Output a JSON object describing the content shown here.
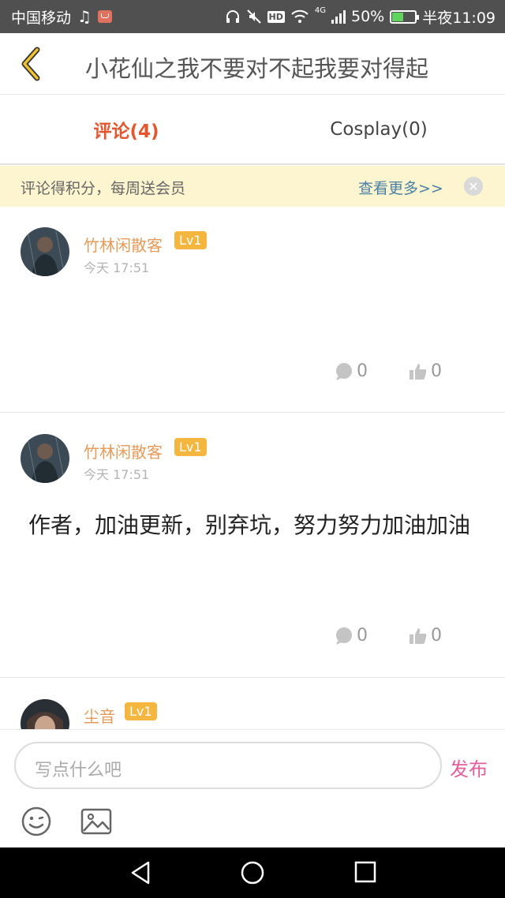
{
  "status_bar": {
    "carrier": "中国移动",
    "network": "4G",
    "battery": "50%",
    "time": "半夜11:09",
    "battery_level": 0.5,
    "icons": [
      "music-note-icon",
      "mail-icon",
      "headphones-icon",
      "mute-icon",
      "hd-icon",
      "wifi-icon",
      "signal-icon",
      "battery-icon"
    ]
  },
  "header": {
    "title": "小花仙之我不要对不起我要对得起",
    "back_icon": "chevron-left-icon"
  },
  "tabs": [
    {
      "label": "评论(4)",
      "active": true
    },
    {
      "label": "Cosplay(0)",
      "active": false
    }
  ],
  "notice": {
    "text": "评论得积分，每周送会员",
    "link": "查看更多>>",
    "close_icon": "close-icon"
  },
  "comments": [
    {
      "username": "竹林闲散客",
      "level": "Lv1",
      "time": "今天 17:51",
      "content": "",
      "replies": "0",
      "likes": "0"
    },
    {
      "username": "竹林闲散客",
      "level": "Lv1",
      "time": "今天 17:51",
      "content": "作者，加油更新，别弃坑，努力努力加油加油",
      "replies": "0",
      "likes": "0"
    },
    {
      "username": "尘音",
      "level": "Lv1"
    }
  ],
  "input": {
    "placeholder": "写点什么吧",
    "publish_label": "发布"
  },
  "colors": {
    "accent_red": "#e4572e",
    "username": "#e59b5b",
    "badge": "#f4b63f",
    "publish": "#e5609a",
    "link": "#4a7fa6"
  }
}
